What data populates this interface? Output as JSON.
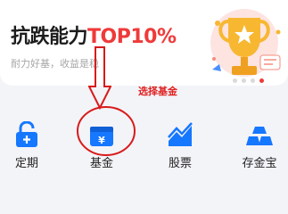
{
  "banner": {
    "title_main": "抗跌能力",
    "title_highlight": "TOP10%",
    "subtitle": "耐力好基，收益是稳"
  },
  "annotation": {
    "text": "选择基金"
  },
  "nav": {
    "items": [
      {
        "label": "定期",
        "icon": "lock-icon"
      },
      {
        "label": "基金",
        "icon": "yuan-chest-icon"
      },
      {
        "label": "股票",
        "icon": "trend-chart-icon"
      },
      {
        "label": "存金宝",
        "icon": "gold-bars-icon"
      }
    ]
  },
  "carousel": {
    "count": 4,
    "active_index": 3
  },
  "colors": {
    "accent_red": "#ef3a3a",
    "icon_blue": "#1677ff",
    "trophy_gold": "#f7b731"
  }
}
